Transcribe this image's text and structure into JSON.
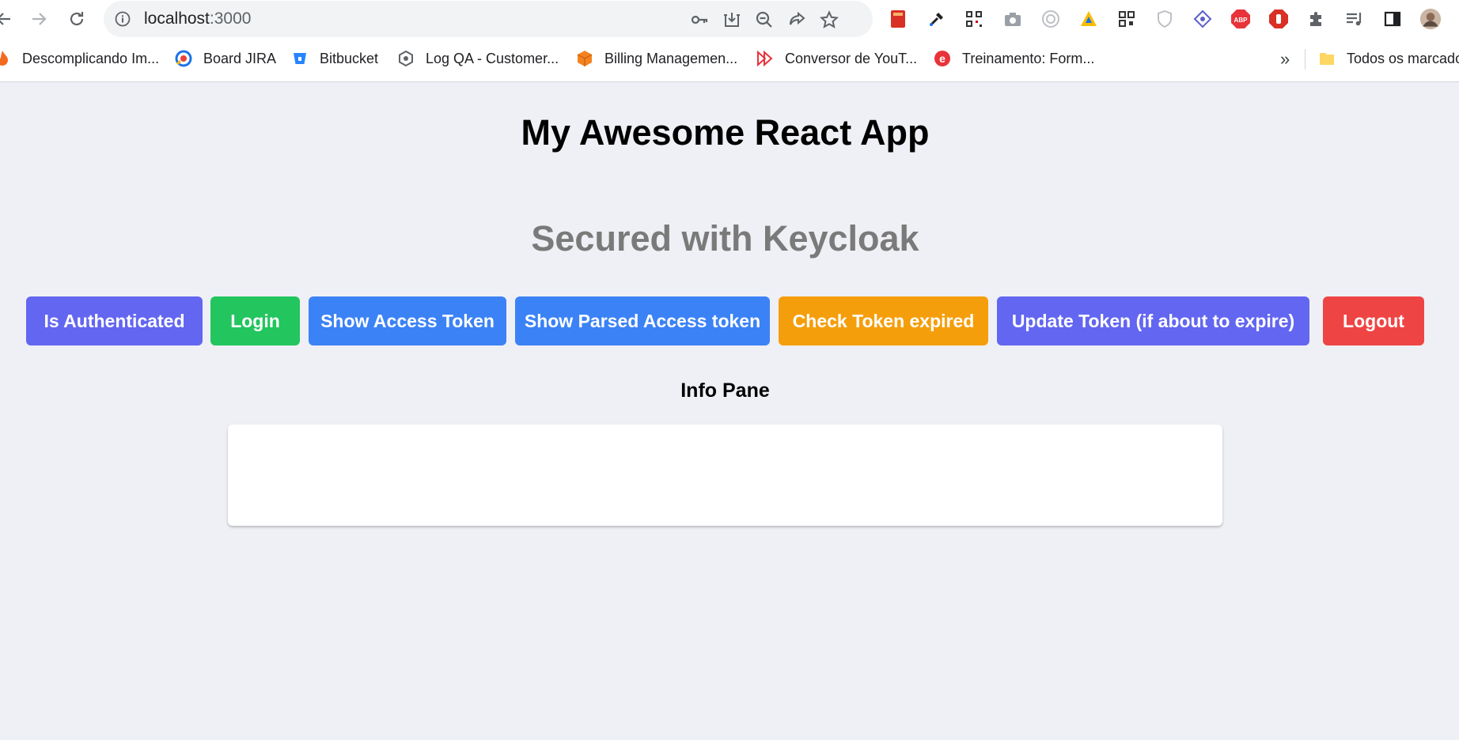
{
  "browser": {
    "url_host": "localhost",
    "url_port": ":3000",
    "bookmarks": [
      {
        "label": "Descomplicando Im..."
      },
      {
        "label": "Board JIRA"
      },
      {
        "label": "Bitbucket"
      },
      {
        "label": "Log QA - Customer..."
      },
      {
        "label": "Billing Managemen..."
      },
      {
        "label": "Conversor de YouT..."
      },
      {
        "label": "Treinamento: Form..."
      }
    ],
    "more_label": "»",
    "all_bookmarks_label": "Todos os marcado"
  },
  "app": {
    "title": "My Awesome React App",
    "subtitle": "Secured with Keycloak",
    "buttons": [
      {
        "label": "Is Authenticated",
        "color": "#6366f1"
      },
      {
        "label": "Login",
        "color": "#22c55e"
      },
      {
        "label": "Show Access Token",
        "color": "#3b82f6"
      },
      {
        "label": "Show Parsed Access token",
        "color": "#3b82f6"
      },
      {
        "label": "Check Token expired",
        "color": "#f59e0b"
      },
      {
        "label": "Update Token (if about to expire)",
        "color": "#6366f1"
      },
      {
        "label": "Logout",
        "color": "#ef4444"
      }
    ],
    "info_heading": "Info Pane",
    "info_content": ""
  }
}
